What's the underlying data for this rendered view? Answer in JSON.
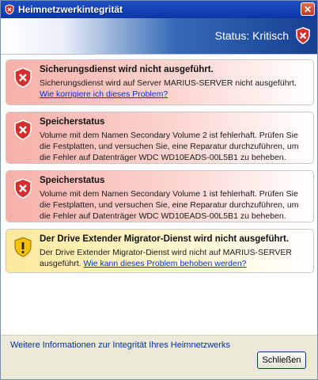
{
  "window": {
    "title": "Heimnetzwerkintegrität",
    "close_glyph": "✕"
  },
  "header": {
    "status": "Status: Kritisch"
  },
  "alerts": [
    {
      "type": "error",
      "title": "Sicherungsdienst wird nicht ausgeführt.",
      "text": "Sicherungsdienst wird auf Server MARIUS-SERVER nicht ausgeführt.",
      "link": "Wie korrigiere ich dieses Problem?"
    },
    {
      "type": "error",
      "title": "Speicherstatus",
      "text": "Volume mit dem Namen Secondary Volume 2 ist fehlerhaft. Prüfen Sie die Festplatten, und versuchen Sie, eine Reparatur durchzuführen, um die Fehler auf Datenträger WDC WD10EADS-00L5B1 zu beheben."
    },
    {
      "type": "error",
      "title": "Speicherstatus",
      "text": "Volume mit dem Namen Secondary Volume 1 ist fehlerhaft. Prüfen Sie die Festplatten, und versuchen Sie, eine Reparatur durchzuführen, um die Fehler auf Datenträger WDC WD10EADS-00L5B1 zu beheben."
    },
    {
      "type": "warning",
      "title": "Der Drive Extender Migrator-Dienst wird nicht ausgeführt.",
      "text": "Der Drive Extender Migrator-Dienst wird nicht auf MARIUS-SERVER ausgeführt.",
      "link": "Wie kann dieses Problem behoben werden?"
    }
  ],
  "footer": {
    "more_info": "Weitere Informationen zur Integrität Ihres Heimnetzwerks",
    "close_label": "Schließen"
  },
  "colors": {
    "error": "#c0392b",
    "warning": "#f1c40f",
    "link": "#0033cc"
  }
}
